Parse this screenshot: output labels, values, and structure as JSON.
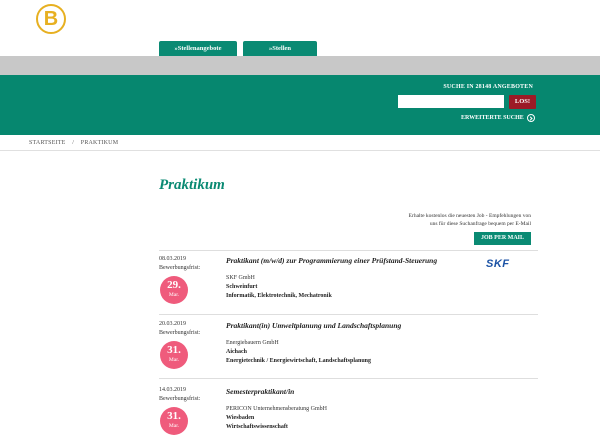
{
  "logo": {
    "letter": "B",
    "color": "#e7b021"
  },
  "tabs": [
    {
      "label": "»Stellenangebote"
    },
    {
      "label": "»Stellen ausschreiben"
    }
  ],
  "search": {
    "title": "SUCHE IN 28148 ANGEBOTEN",
    "placeholder": "",
    "button_label": "LOS!",
    "advanced_label": "ERWEITERTE SUCHE"
  },
  "breadcrumb": {
    "home": "STARTSEITE",
    "separator": "/",
    "current": "PRAKTIKUM"
  },
  "page": {
    "title": "Praktikum",
    "notify_text_line1": "Erhalte kostenlos die neuesten Job - Empfehlungen von",
    "notify_text_line2": "uns für diese Suchanfrage bequem per E-Mail",
    "mail_button": "JOB PER MAIL"
  },
  "jobs": [
    {
      "date": "08.03.2019",
      "deadline_label": "Bewerbungsfrist:",
      "deadline_day": "29.",
      "deadline_month": "Mar.",
      "title": "Praktikant (m/w/d) zur Programmierung einer Prüfstand-Steuerung",
      "company": "SKF GmbH",
      "city": "Schweinfurt",
      "field": "Informatik, Elektrotechnik, Mechatronik",
      "company_logo": "SKF"
    },
    {
      "date": "20.03.2019",
      "deadline_label": "Bewerbungsfrist:",
      "deadline_day": "31.",
      "deadline_month": "Mar.",
      "title": "Praktikant(in) Umweltplanung und Landschaftsplanung",
      "company": "Energiebauern GmbH",
      "city": "Aichach",
      "field": "Energietechnik / Energiewirtschaft, Landschaftsplanung"
    },
    {
      "date": "14.03.2019",
      "deadline_label": "Bewerbungsfrist:",
      "deadline_day": "31.",
      "deadline_month": "Mar.",
      "title": "Semesterpraktikant/in",
      "company": "PERICON Unternehmensberatung GmbH",
      "city": "Wiesbaden",
      "field": "Wirtschaftswissenschaft"
    }
  ],
  "colors": {
    "brand_green": "#0a8a73",
    "band_green": "#06876f",
    "grey_band": "#c8c8c8",
    "search_button": "#9c1a26",
    "deadline_badge": "#ef5b7c",
    "skf_blue": "#1c53a5"
  }
}
